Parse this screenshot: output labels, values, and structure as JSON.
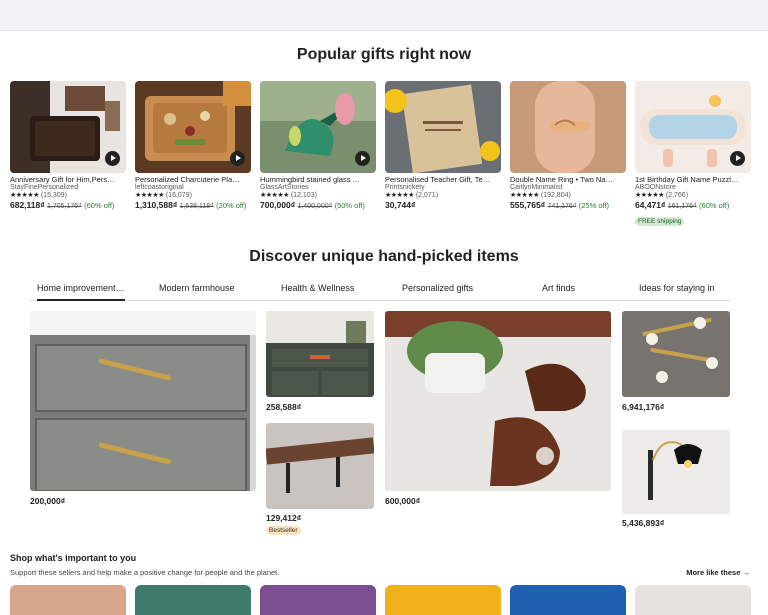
{
  "popular": {
    "title": "Popular gifts right now",
    "items": [
      {
        "title": "Anniversary Gift for Him,Pers…",
        "shop": "StayFinePersonalized",
        "stars": "★★★★★",
        "count": "(15,309)",
        "price": "682,118₫",
        "old": "1,705,176₫",
        "off": "(60% off)",
        "free": "",
        "video": true
      },
      {
        "title": "Personalized Charcuterie Pla…",
        "shop": "leftcoastoriginal",
        "stars": "★★★★★",
        "count": "(16,079)",
        "price": "1,310,588₫",
        "old": "1,638,118₫",
        "off": "(20% off)",
        "free": "",
        "video": true
      },
      {
        "title": "Hummingbird stained glass …",
        "shop": "GlassArtStories",
        "stars": "★★★★★",
        "count": "(12,103)",
        "price": "700,000₫",
        "old": "1,400,000₫",
        "off": "(50% off)",
        "free": "",
        "video": true
      },
      {
        "title": "Personalised Teacher Gift, Te…",
        "shop": "Printsnickety",
        "stars": "★★★★★",
        "count": "(2,071)",
        "price": "30,744₫",
        "old": "",
        "off": "",
        "free": "",
        "video": false
      },
      {
        "title": "Double Name Ring • Two Na…",
        "shop": "CaitlynMinimalist",
        "stars": "★★★★★",
        "count": "(192,804)",
        "price": "555,765₫",
        "old": "741,176₫",
        "off": "(25% off)",
        "free": "",
        "video": false
      },
      {
        "title": "1st Birthday Gift Name Puzzl…",
        "shop": "ABOONstore",
        "stars": "★★★★★",
        "count": "(2,766)",
        "price": "64,471₫",
        "old": "161,176₫",
        "off": "(60% off)",
        "free": "FREE shipping",
        "video": true
      }
    ]
  },
  "discover": {
    "title": "Discover unique hand-picked items",
    "tabs": [
      "Home improvement…",
      "Modern farmhouse",
      "Health & Wellness",
      "Personalized gifts",
      "Art finds",
      "Ideas for staying in"
    ],
    "prices": {
      "drawer": "200,000₫",
      "cabinet": "258,588₫",
      "shelf": "129,412₫",
      "bookend": "600,000₫",
      "lamp_wall": "6,941,176₫",
      "lamp_arm": "5,436,893₫"
    },
    "badge": "Bestseller"
  },
  "shop": {
    "title": "Shop what's important to you",
    "subtitle": "Support these sellers and help make a positive change for people and the planet.",
    "more": "More like these"
  },
  "colors": {
    "sale_green": "#2d7a36",
    "free_bg": "#d4e9d7",
    "bestseller_bg": "#fde3b8"
  }
}
